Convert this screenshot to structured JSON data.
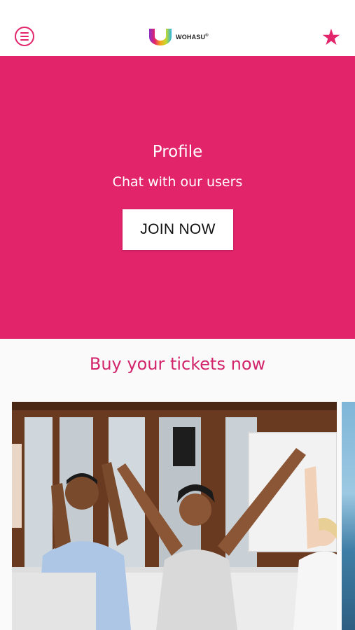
{
  "header": {
    "menu_icon": "hamburger-menu-icon",
    "logo_text": "WOHASU",
    "logo_mark": "®",
    "favorite_icon": "star-icon",
    "accent_color": "#e2246a"
  },
  "hero": {
    "title": "Profile",
    "subtitle": "Chat with our users",
    "button_label": "JOIN NOW",
    "background_color": "#e2246a"
  },
  "tickets": {
    "heading": "Buy your tickets now",
    "heading_color": "#d2246a",
    "carousel": [
      {
        "image": "people-celebrating-office-photo"
      },
      {
        "image": "sea-mountain-photo"
      }
    ]
  }
}
